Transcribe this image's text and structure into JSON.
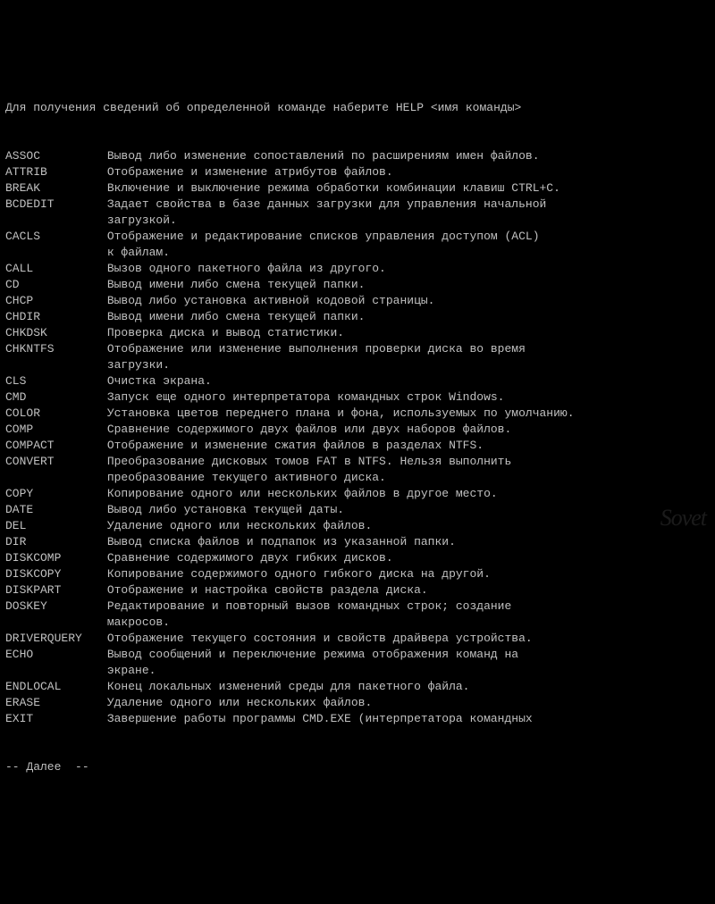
{
  "intro": "Для получения сведений об определенной команде наберите HELP <имя команды>",
  "commands": [
    {
      "name": "ASSOC",
      "desc": "Вывод либо изменение сопоставлений по расширениям имен файлов."
    },
    {
      "name": "ATTRIB",
      "desc": "Отображение и изменение атрибутов файлов."
    },
    {
      "name": "BREAK",
      "desc": "Включение и выключение режима обработки комбинации клавиш CTRL+C."
    },
    {
      "name": "BCDEDIT",
      "desc": "Задает свойства в базе данных загрузки для управления начальной\nзагрузкой."
    },
    {
      "name": "CACLS",
      "desc": "Отображение и редактирование списков управления доступом (ACL)\nк файлам."
    },
    {
      "name": "CALL",
      "desc": "Вызов одного пакетного файла из другого."
    },
    {
      "name": "CD",
      "desc": "Вывод имени либо смена текущей папки."
    },
    {
      "name": "CHCP",
      "desc": "Вывод либо установка активной кодовой страницы."
    },
    {
      "name": "CHDIR",
      "desc": "Вывод имени либо смена текущей папки."
    },
    {
      "name": "CHKDSK",
      "desc": "Проверка диска и вывод статистики."
    },
    {
      "name": "CHKNTFS",
      "desc": "Отображение или изменение выполнения проверки диска во время\nзагрузки."
    },
    {
      "name": "CLS",
      "desc": "Очистка экрана."
    },
    {
      "name": "CMD",
      "desc": "Запуск еще одного интерпретатора командных строк Windows."
    },
    {
      "name": "COLOR",
      "desc": "Установка цветов переднего плана и фона, используемых по умолчанию."
    },
    {
      "name": "COMP",
      "desc": "Сравнение содержимого двух файлов или двух наборов файлов."
    },
    {
      "name": "COMPACT",
      "desc": "Отображение и изменение сжатия файлов в разделах NTFS."
    },
    {
      "name": "CONVERT",
      "desc": "Преобразование дисковых томов FAT в NTFS. Нельзя выполнить\nпреобразование текущего активного диска."
    },
    {
      "name": "COPY",
      "desc": "Копирование одного или нескольких файлов в другое место."
    },
    {
      "name": "DATE",
      "desc": "Вывод либо установка текущей даты."
    },
    {
      "name": "DEL",
      "desc": "Удаление одного или нескольких файлов."
    },
    {
      "name": "DIR",
      "desc": "Вывод списка файлов и подпапок из указанной папки."
    },
    {
      "name": "DISKCOMP",
      "desc": "Сравнение содержимого двух гибких дисков."
    },
    {
      "name": "DISKCOPY",
      "desc": "Копирование содержимого одного гибкого диска на другой."
    },
    {
      "name": "DISKPART",
      "desc": "Отображение и настройка свойств раздела диска."
    },
    {
      "name": "DOSKEY",
      "desc": "Редактирование и повторный вызов командных строк; создание\nмакросов."
    },
    {
      "name": "DRIVERQUERY",
      "desc": "Отображение текущего состояния и свойств драйвера устройства."
    },
    {
      "name": "ECHO",
      "desc": "Вывод сообщений и переключение режима отображения команд на\nэкране."
    },
    {
      "name": "ENDLOCAL",
      "desc": "Конец локальных изменений среды для пакетного файла."
    },
    {
      "name": "ERASE",
      "desc": "Удаление одного или нескольких файлов."
    },
    {
      "name": "EXIT",
      "desc": "Завершение работы программы CMD.EXE (интерпретатора командных"
    }
  ],
  "more_prompt": "-- Далее  --",
  "watermark": "Sovet"
}
